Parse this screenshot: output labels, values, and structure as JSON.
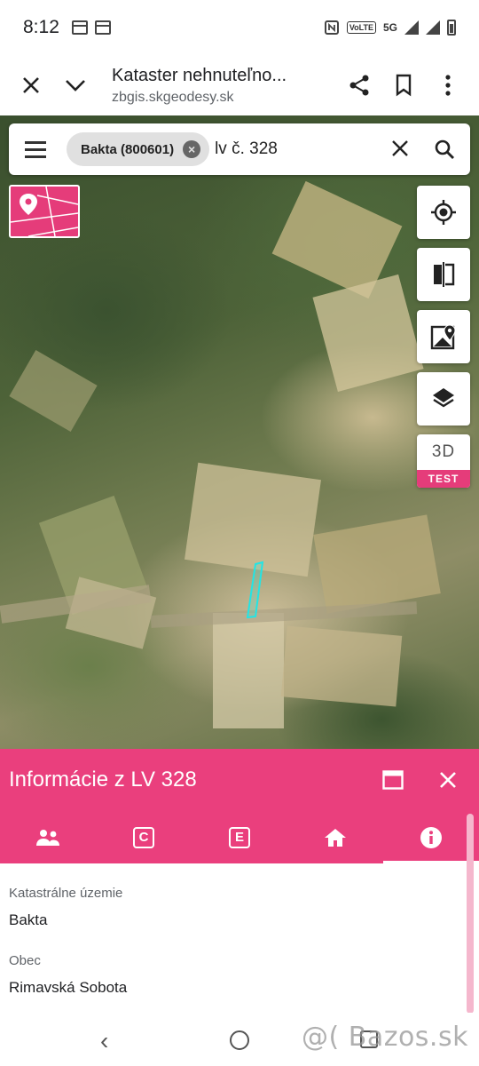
{
  "status_bar": {
    "time": "8:12",
    "network": "5G",
    "volte": "VoLTE"
  },
  "browser": {
    "title": "Kataster nehnuteľno...",
    "url": "zbgis.skgeodesy.sk"
  },
  "search": {
    "chip_label": "Bakta (800601)",
    "query": "lv č. 328"
  },
  "map_controls": {
    "three_d_label": "3D",
    "test_label": "TEST"
  },
  "panel": {
    "title": "Informácie z LV 328",
    "tabs": [
      "owners",
      "C",
      "E",
      "building",
      "info"
    ],
    "active_tab": "info",
    "fields": [
      {
        "label": "Katastrálne územie",
        "value": "Bakta"
      },
      {
        "label": "Obec",
        "value": "Rimavská Sobota"
      }
    ]
  },
  "accent_color": "#ea3f7d",
  "watermark": "@( Bazos.sk"
}
